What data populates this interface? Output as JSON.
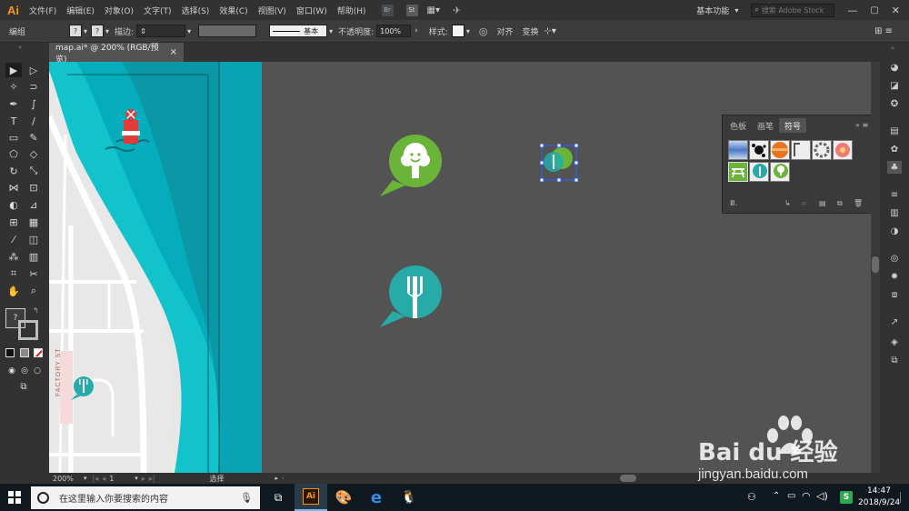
{
  "app": {
    "logo": "Ai"
  },
  "menu": {
    "items": [
      "文件(F)",
      "编辑(E)",
      "对象(O)",
      "文字(T)",
      "选择(S)",
      "效果(C)",
      "视图(V)",
      "窗口(W)",
      "帮助(H)"
    ],
    "bridge": "Br",
    "stock": "St",
    "workspace": "基本功能",
    "search_placeholder": "搜索 Adobe Stock"
  },
  "control_bar": {
    "selection_label": "编组",
    "stroke_label": "描边:",
    "stroke_style": "基本",
    "opacity_label": "不透明度:",
    "opacity_value": "100%",
    "style_label": "样式:",
    "align_label": "对齐",
    "transform_label": "变换"
  },
  "document_tab": {
    "title": "map.ai* @ 200% (RGB/预览)",
    "close": "×"
  },
  "artboard": {
    "street_label": "FACTORY ST"
  },
  "symbols_panel": {
    "tabs": [
      "色板",
      "画笔",
      "符号"
    ],
    "active_tab": "符号",
    "swatch_names": [
      "blue-gradient-symbol",
      "splash-symbol",
      "orange-ball-symbol",
      "bracket-frame-symbol",
      "ring-symbol",
      "flower-symbol",
      "picnic-table-symbol",
      "fork-marker-symbol",
      "tree-marker-symbol"
    ]
  },
  "status_bar": {
    "zoom": "200%",
    "page": "1",
    "tool": "选择"
  },
  "taskbar": {
    "search_placeholder": "在这里输入你要搜索的内容",
    "ai_label": "Ai",
    "ime": "S",
    "time": "14:47",
    "date": "2018/9/24"
  },
  "watermark": {
    "brand": "Bai du 经验",
    "url": "jingyan.baidu.com"
  },
  "colors": {
    "ai_orange": "#f7951e",
    "tree_green": "#6bb43a",
    "fork_teal": "#27aaa8",
    "water_teal": "#10b5c0",
    "deep_teal": "#0a8fa0",
    "selection_blue": "#2d62ff"
  }
}
